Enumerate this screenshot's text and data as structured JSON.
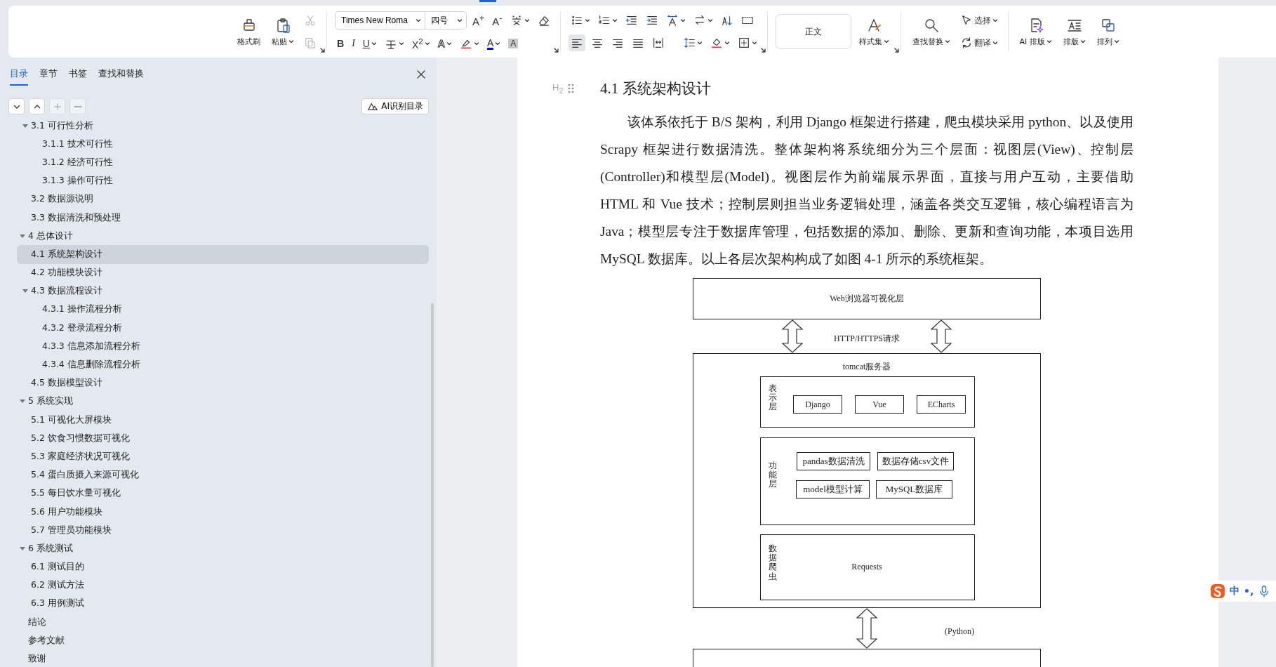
{
  "toolbar": {
    "clipboard": [
      {
        "kind": "format-painter",
        "label": "格式刷",
        "dropdown": false
      },
      {
        "kind": "paste",
        "label": "粘贴",
        "dropdown": true
      }
    ],
    "edit_actions": [
      {
        "kind": "cut",
        "disabled": true
      },
      {
        "kind": "copy",
        "disabled": true
      }
    ],
    "font": {
      "name": "Times New Roma",
      "size": "四号"
    },
    "font_tools": [
      {
        "kind": "grow",
        "glyph": "A$^{+}$",
        "dropdown": false
      },
      {
        "kind": "shrink",
        "glyph": "A$^{-}$",
        "dropdown": false
      },
      {
        "kind": "phonetic",
        "dropdown": true
      },
      {
        "kind": "eraser",
        "dropdown": false
      }
    ],
    "format_tools": [
      {
        "kind": "bold",
        "glyph": "B",
        "dropdown": false
      },
      {
        "kind": "italic",
        "glyph": "I",
        "dropdown": false
      },
      {
        "kind": "underline",
        "glyph": "U",
        "dropdown": true
      },
      {
        "kind": "strike",
        "dropdown": true
      },
      {
        "kind": "superscript",
        "glyph": "X$^{2}$",
        "dropdown": true
      },
      {
        "kind": "effect",
        "glyph": "A",
        "dropdown": true
      },
      {
        "kind": "highlight",
        "dropdown": true
      },
      {
        "kind": "font-color",
        "glyph": "A",
        "dropdown": true
      },
      {
        "kind": "shading",
        "glyph": "A",
        "dropdown": false
      }
    ],
    "paragraph_tools": [
      {
        "kind": "bullets",
        "dropdown": true
      },
      {
        "kind": "numbering",
        "dropdown": true
      },
      {
        "kind": "outdent",
        "dropdown": false
      },
      {
        "kind": "indent",
        "dropdown": false
      },
      {
        "kind": "text-direction",
        "dropdown": true
      },
      {
        "kind": "swap",
        "dropdown": true
      },
      {
        "kind": "sort",
        "dropdown": false
      },
      {
        "kind": "grid",
        "dropdown": false
      }
    ],
    "alignment": [
      {
        "kind": "left",
        "selected": true
      },
      {
        "kind": "center",
        "selected": false
      },
      {
        "kind": "right",
        "selected": false
      },
      {
        "kind": "justify",
        "selected": false
      },
      {
        "kind": "distribute",
        "selected": false
      }
    ],
    "paragraph_tools_2": [
      {
        "kind": "line-spacing",
        "dropdown": true
      },
      {
        "kind": "para-shading",
        "dropdown": true
      },
      {
        "kind": "borders",
        "dropdown": true
      }
    ],
    "style_preview": "正文",
    "style_set": {
      "kind": "style-set",
      "label": "样式集",
      "dropdown": true
    },
    "find": {
      "kind": "find",
      "label": "查找替换",
      "dropdown": true
    },
    "small_actions": [
      {
        "kind": "select",
        "label": "选择",
        "dropdown": true
      },
      {
        "kind": "translate",
        "label": "翻译",
        "dropdown": true
      }
    ],
    "layout_actions": [
      {
        "kind": "ai-layout",
        "label": "AI 排版",
        "dropdown": true
      },
      {
        "kind": "layout",
        "label": "排版",
        "dropdown": true
      },
      {
        "kind": "arrange",
        "label": "排列",
        "dropdown": true
      }
    ]
  },
  "sidebar": {
    "tabs": [
      {
        "label": "目录",
        "selected": true
      },
      {
        "label": "章节",
        "selected": false
      },
      {
        "label": "书签",
        "selected": false
      },
      {
        "label": "查找和替换",
        "selected": false
      }
    ],
    "tree_buttons": [
      {
        "kind": "expand",
        "disabled": false
      },
      {
        "kind": "collapse",
        "disabled": false
      },
      {
        "kind": "add",
        "disabled": true
      },
      {
        "kind": "remove",
        "disabled": true
      }
    ],
    "ai_button": "AI识别目录",
    "toc": [
      {
        "children": [
          {
            "label": "3.1  可行性分析",
            "selected": false,
            "expanded": true,
            "children": [
              {
                "label": "3.1.1  技术可行性",
                "selected": false
              },
              {
                "label": "3.1.2  经济可行性",
                "selected": false
              },
              {
                "label": "3.1.3  操作可行性",
                "selected": false
              }
            ]
          },
          {
            "label": "3.2 数据源说明",
            "selected": false
          },
          {
            "label": "3.3 数据清洗和预处理",
            "selected": false
          }
        ]
      },
      {
        "label": "4 总体设计",
        "selected": false,
        "expanded": true,
        "children": [
          {
            "label": "4.1 系统架构设计",
            "selected": true
          },
          {
            "label": "4.2 功能模块设计",
            "selected": false
          },
          {
            "label": "4.3 数据流程设计",
            "selected": false,
            "expanded": true,
            "children": [
              {
                "label": "4.3.1 操作流程分析",
                "selected": false
              },
              {
                "label": "4.3.2 登录流程分析",
                "selected": false
              },
              {
                "label": "4.3.3 信息添加流程分析",
                "selected": false
              },
              {
                "label": "4.3.4 信息删除流程分析",
                "selected": false
              }
            ]
          },
          {
            "label": "4.5  数据模型设计",
            "selected": false
          }
        ]
      },
      {
        "label": "5 系统实现",
        "selected": false,
        "expanded": true,
        "children": [
          {
            "label": "5.1  可视化大屏模块",
            "selected": false
          },
          {
            "label": "5.2  饮食习惯数据可视化",
            "selected": false
          },
          {
            "label": "5.3  家庭经济状况可视化",
            "selected": false
          },
          {
            "label": "5.4  蛋白质摄入来源可视化",
            "selected": false
          },
          {
            "label": "5.5  每日饮水量可视化",
            "selected": false
          },
          {
            "label": "5.6  用户功能模块",
            "selected": false
          },
          {
            "label": "5.7  管理员功能模块",
            "selected": false
          }
        ]
      },
      {
        "label": "6 系统测试",
        "selected": false,
        "expanded": true,
        "children": [
          {
            "label": "6.1  测试目的",
            "selected": false
          },
          {
            "label": "6.2  测试方法",
            "selected": false
          },
          {
            "label": "6.3  用例测试",
            "selected": false
          }
        ]
      },
      {
        "label": "结论",
        "selected": false
      },
      {
        "label": "参考文献",
        "selected": false
      },
      {
        "label": "致谢",
        "selected": false
      }
    ]
  },
  "document": {
    "heading_marker": "H$_{2}$",
    "heading": "4.1 系统架构设计",
    "paragraph": "该体系依托于 B/S 架构，利用 Django 框架进行搭建，爬虫模块采用 python、以及使用 Scrapy 框架进行数据清洗。整体架构将系统细分为三个层面：视图层(View)、控制层(Controller)和模型层(Model)。视图层作为前端展示界面，直接与用户互动，主要借助 HTML 和 Vue 技术；控制层则担当业务逻辑处理，涵盖各类交互逻辑，核心编程语言为 Java；模型层专注于数据库管理，包括数据的添加、删除、更新和查询功能，本项目选用 MySQL 数据库。以上各层次架构构成了如图 4-1 所示的系统框架。",
    "figure": {
      "top_layer": "Web浏览器可视化层",
      "protocol": "HTTP/HTTPS请求",
      "server": "tomcat服务器",
      "layers": [
        {
          "kind": "row",
          "name": "表示层",
          "items": [
            "Django",
            "Vue",
            "ECharts"
          ]
        },
        {
          "kind": "grid",
          "name": "功能层",
          "items": [
            "pandas数据清洗",
            "数据存储csv文件",
            "model模型计算",
            "MySQL数据库"
          ]
        },
        {
          "kind": "single",
          "name": "数据爬虫",
          "items": [
            "Requests"
          ]
        }
      ],
      "crawler_note": "(Python)"
    }
  },
  "ime_bar": {
    "mode": "中",
    "punctuation": "•,"
  }
}
